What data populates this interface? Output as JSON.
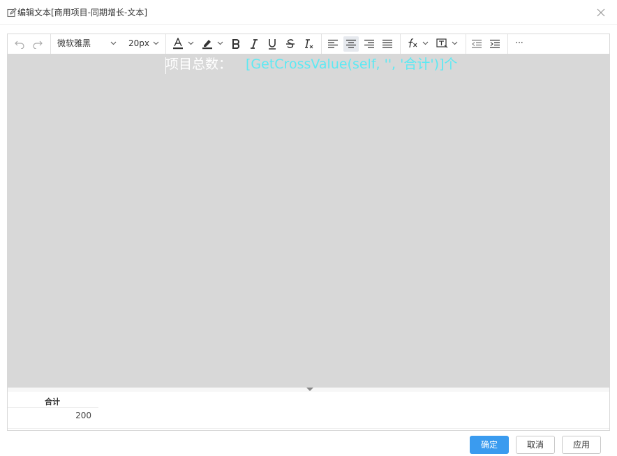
{
  "dialog": {
    "title": "编辑文本[商用项目-同期增长-文本]",
    "icons": {
      "edit": "edit-icon",
      "close": "close-icon"
    }
  },
  "toolbar": {
    "font_family": "微软雅黑",
    "font_size": "20px",
    "more_label": "···",
    "active_button": "align-center"
  },
  "editor": {
    "label_text": "项目总数：",
    "formula_text": "[GetCrossValue(self, '', '合计')]",
    "suffix_text": "个",
    "colors": {
      "background": "#d8d8d8",
      "label": "#ffffff",
      "formula": "#5ce9f3"
    }
  },
  "preview": {
    "column_header": "合计",
    "cell_value": "200"
  },
  "footer": {
    "confirm_label": "确定",
    "cancel_label": "取消",
    "apply_label": "应用",
    "accent_color": "#3a9bef"
  }
}
